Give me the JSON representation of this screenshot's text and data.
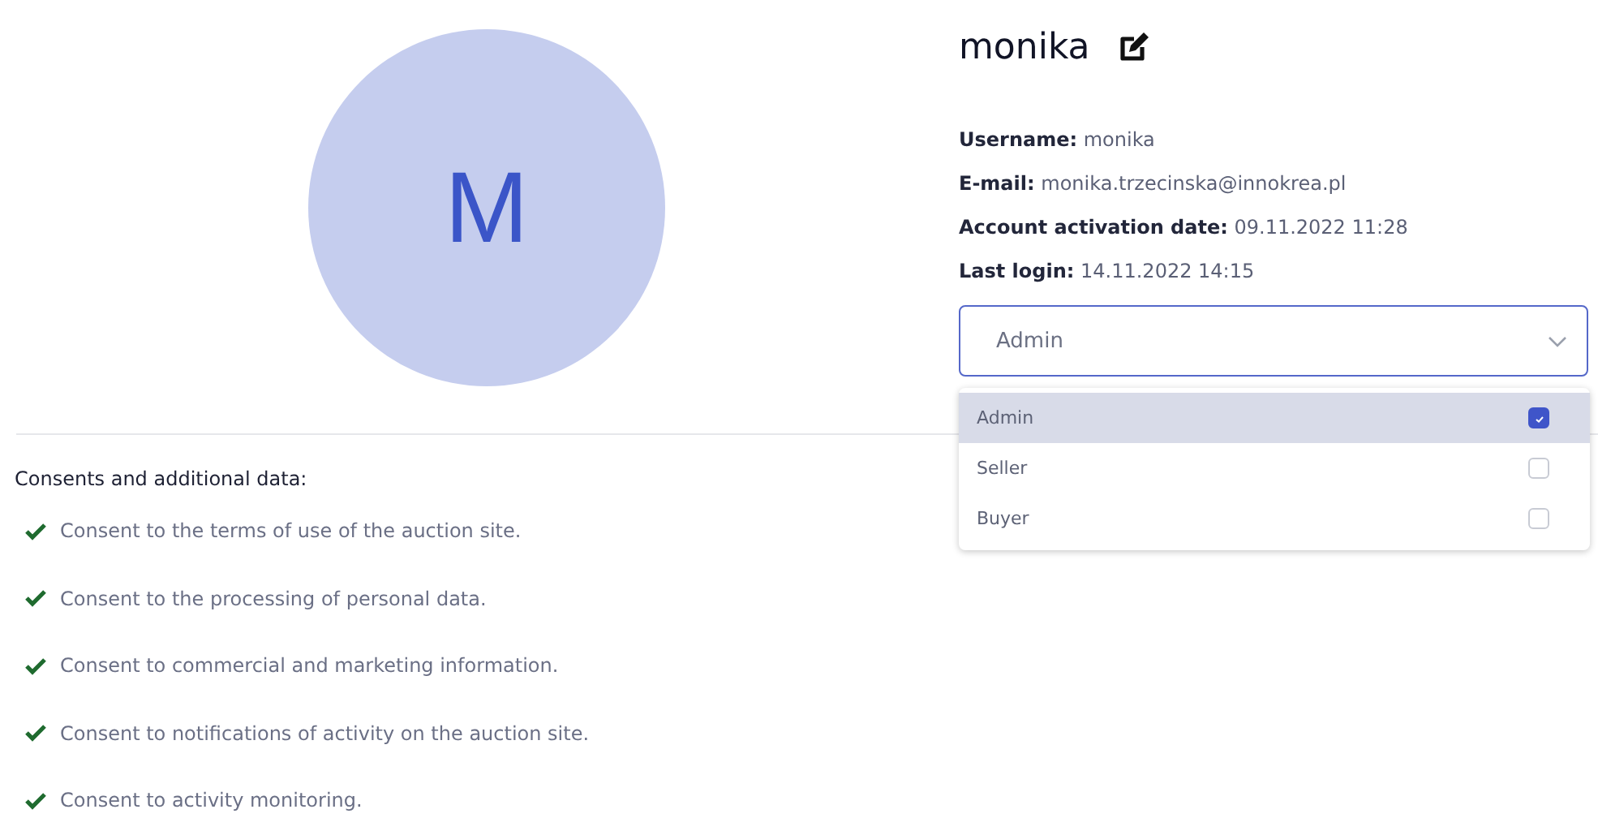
{
  "avatar": {
    "initial": "M"
  },
  "profile": {
    "name": "monika",
    "details": [
      {
        "label": "Username:",
        "value": "monika"
      },
      {
        "label": "E-mail:",
        "value": "monika.trzecinska@innokrea.pl"
      },
      {
        "label": "Account activation date:",
        "value": "09.11.2022 11:28"
      },
      {
        "label": "Last login:",
        "value": "14.11.2022 14:15"
      }
    ]
  },
  "role_select": {
    "value": "Admin",
    "expanded": true,
    "options": [
      {
        "label": "Admin",
        "selected": true
      },
      {
        "label": "Seller",
        "selected": false
      },
      {
        "label": "Buyer",
        "selected": false
      }
    ]
  },
  "consents": {
    "heading": "Consents and additional data:",
    "items": [
      {
        "text": "Consent to the terms of use of the auction site.",
        "checked": true
      },
      {
        "text": "Consent to the processing of personal data.",
        "checked": true
      },
      {
        "text": "Consent to commercial and marketing information.",
        "checked": true
      },
      {
        "text": "Consent to notifications of activity on the auction site.",
        "checked": true
      },
      {
        "text": "Consent to activity monitoring.",
        "checked": true
      }
    ]
  }
}
